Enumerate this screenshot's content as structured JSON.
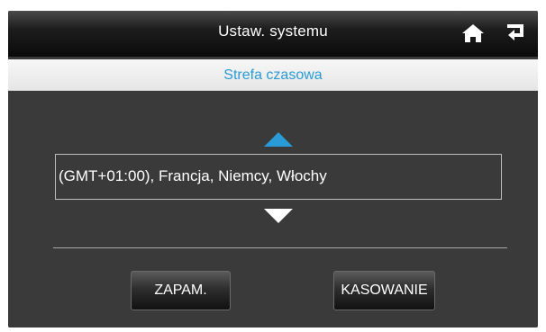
{
  "header": {
    "title": "Ustaw. systemu",
    "home_icon": "home-icon",
    "back_icon": "return-icon"
  },
  "subheader": {
    "title": "Strefa czasowa"
  },
  "timezone": {
    "value": "(GMT+01:00), Francja, Niemcy, Włochy",
    "up_icon": "triangle-up-icon",
    "down_icon": "triangle-down-icon"
  },
  "buttons": {
    "save_label": "ZAPAM.",
    "clear_label": "KASOWANIE"
  },
  "colors": {
    "accent": "#2a9bd6",
    "background": "#3a3a3a",
    "titlebar": "#0a0a0a",
    "subbar": "#ececec"
  }
}
